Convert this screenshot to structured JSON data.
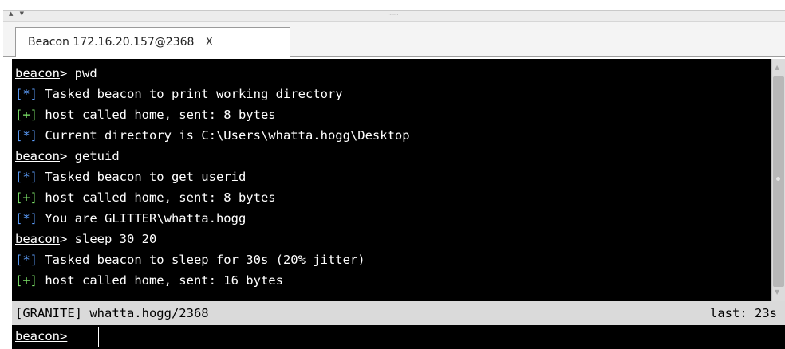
{
  "splitter": {
    "arrows": "▲ ▼",
    "grip": "·······"
  },
  "tab": {
    "label": "Beacon 172.16.20.157@2368",
    "close": "X"
  },
  "colors": {
    "console_bg": "#000000",
    "info_tag": "#5ea0ff",
    "ok_tag": "#7ee66a",
    "text": "#ffffff",
    "status_bg": "#dadada"
  },
  "console": {
    "lines": [
      {
        "prompt": "beacon",
        "text": "> pwd"
      },
      {
        "tag": "[*]",
        "tag_type": "info",
        "text": " Tasked beacon to print working directory"
      },
      {
        "tag": "[+]",
        "tag_type": "ok",
        "text": " host called home, sent: 8 bytes"
      },
      {
        "tag": "[*]",
        "tag_type": "info",
        "text": " Current directory is C:\\Users\\whatta.hogg\\Desktop"
      },
      {
        "prompt": "beacon",
        "text": "> getuid"
      },
      {
        "tag": "[*]",
        "tag_type": "info",
        "text": " Tasked beacon to get userid"
      },
      {
        "tag": "[+]",
        "tag_type": "ok",
        "text": " host called home, sent: 8 bytes"
      },
      {
        "tag": "[*]",
        "tag_type": "info",
        "text": " You are GLITTER\\whatta.hogg"
      },
      {
        "prompt": "beacon",
        "text": "> sleep 30 20"
      },
      {
        "tag": "[*]",
        "tag_type": "info",
        "text": " Tasked beacon to sleep for 30s (20% jitter)"
      },
      {
        "tag": "[+]",
        "tag_type": "ok",
        "text": " host called home, sent: 16 bytes"
      }
    ]
  },
  "status": {
    "left": "[GRANITE] whatta.hogg/2368",
    "right": "last: 23s"
  },
  "input": {
    "prompt": "beacon",
    "suffix": ">",
    "value": ""
  }
}
